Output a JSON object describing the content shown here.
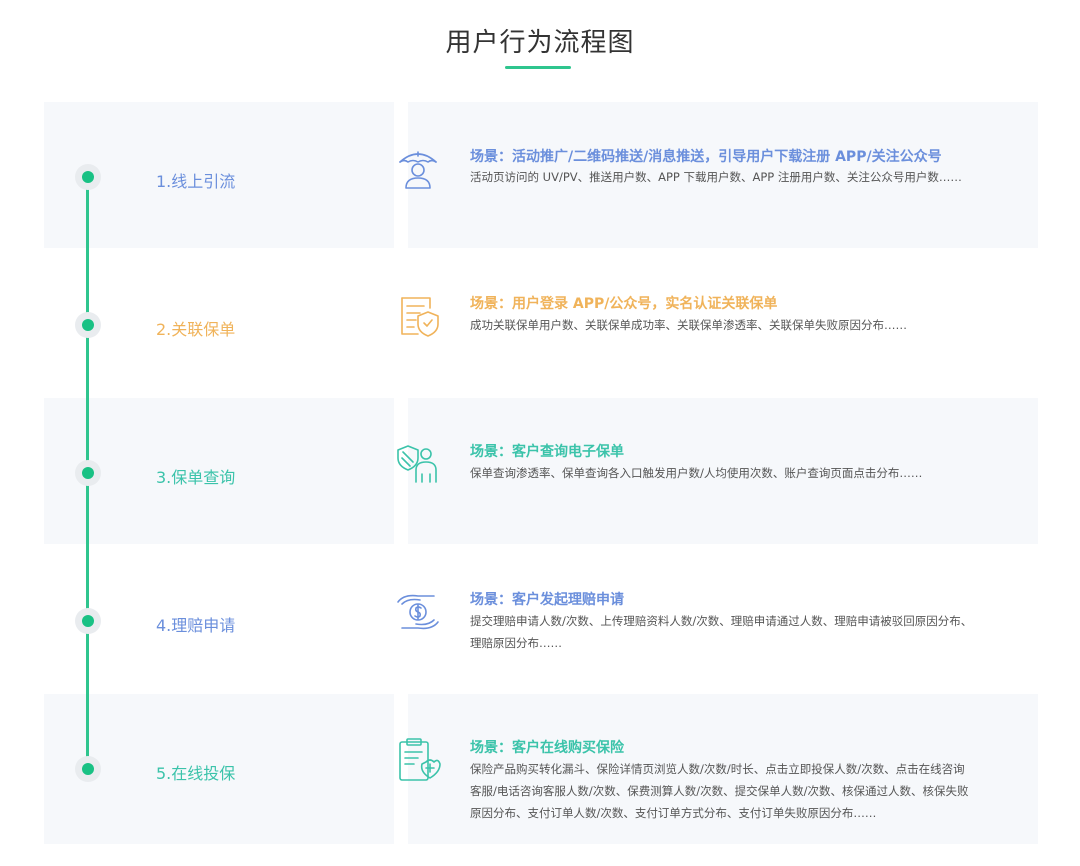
{
  "title": "用户行为流程图",
  "colors": {
    "accent": "#2fc58e",
    "step1": "#6b8fdc",
    "step2": "#f0b35a",
    "step3": "#3bc3aa",
    "step4": "#6b8fdc",
    "step5": "#3bc3aa"
  },
  "steps": [
    {
      "label": "1.线上引流",
      "icon": "umbrella-person-icon",
      "scene": "场景：活动推广/二维码推送/消息推送，引导用户下载注册 APP/关注公众号",
      "desc": "活动页访问的 UV/PV、推送用户数、APP 下载用户数、APP 注册用户数、关注公众号用户数……"
    },
    {
      "label": "2.关联保单",
      "icon": "policy-shield-icon",
      "scene": "场景：用户登录 APP/公众号，实名认证关联保单",
      "desc": "成功关联保单用户数、关联保单成功率、关联保单渗透率、关联保单失败原因分布……"
    },
    {
      "label": "3.保单查询",
      "icon": "person-shield-icon",
      "scene": "场景：客户查询电子保单",
      "desc": "保单查询渗透率、保单查询各入口触发用户数/人均使用次数、账户查询页面点击分布……"
    },
    {
      "label": "4.理赔申请",
      "icon": "hands-coin-icon",
      "scene": "场景：客户发起理赔申请",
      "desc": "提交理赔申请人数/次数、上传理赔资料人数/次数、理赔申请通过人数、理赔申请被驳回原因分布、理赔原因分布……"
    },
    {
      "label": "5.在线投保",
      "icon": "clipboard-medical-icon",
      "scene": "场景：客户在线购买保险",
      "desc": "保险产品购买转化漏斗、保险详情页浏览人数/次数/时长、点击立即投保人数/次数、点击在线咨询客服/电话咨询客服人数/次数、保费测算人数/次数、提交保单人数/次数、核保通过人数、核保失败原因分布、支付订单人数/次数、支付订单方式分布、支付订单失败原因分布……"
    }
  ]
}
